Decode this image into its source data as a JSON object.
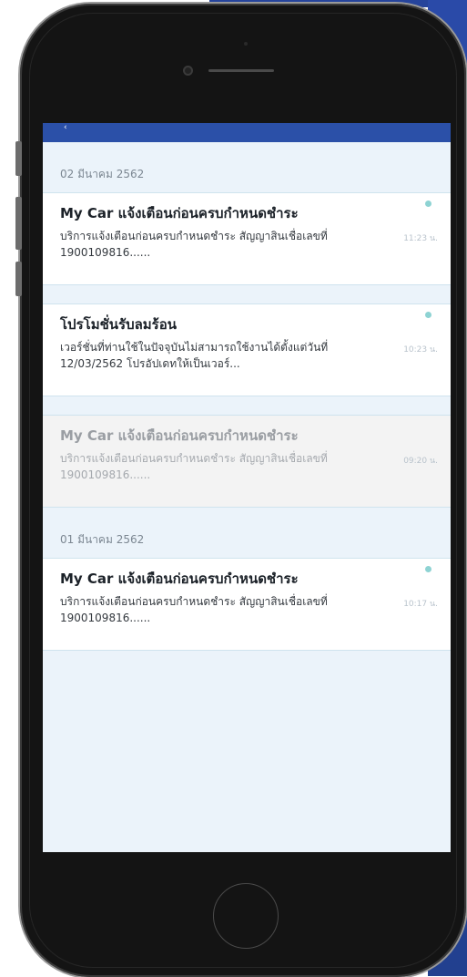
{
  "app": {
    "back_glyph": "‹"
  },
  "groups": [
    {
      "date": "02 มีนาคม 2562",
      "items": [
        {
          "title": "My Car แจ้งเตือนก่อนครบกำหนดชำระ",
          "body": "บริการแจ้งเตือนก่อนครบกำหนดชำระ สัญญาสินเชื่อเลขที่ 1900109816......",
          "time": "11:23 น.",
          "unread": true
        },
        {
          "title": "โปรโมชั่นรับลมร้อน",
          "body": "เวอร์ชั่นที่ท่านใช้ในปัจจุบันไม่สามารถใช้งานได้ตั้งแต่วันที่ 12/03/2562 โปรอัปเดทให้เป็นเวอร์...",
          "time": "10:23 น.",
          "unread": true
        },
        {
          "title": "My Car แจ้งเตือนก่อนครบกำหนดชำระ",
          "body": "บริการแจ้งเตือนก่อนครบกำหนดชำระ สัญญาสินเชื่อเลขที่ 1900109816......",
          "time": "09:20 น.",
          "unread": false
        }
      ]
    },
    {
      "date": "01 มีนาคม 2562",
      "items": [
        {
          "title": "My Car แจ้งเตือนก่อนครบกำหนดชำระ",
          "body": "บริการแจ้งเตือนก่อนครบกำหนดชำระ สัญญาสินเชื่อเลขที่ 1900109816......",
          "time": "10:17 น.",
          "unread": true
        }
      ]
    }
  ],
  "colors": {
    "app_bar": "#2b50a8",
    "unread_dot": "#8ed3d3",
    "screen_bg": "#ebf3fa",
    "read_card_bg": "#f3f3f3"
  },
  "icons": {
    "back": "back-arrow-icon",
    "camera": "front-camera-icon",
    "home": "home-button-icon"
  }
}
